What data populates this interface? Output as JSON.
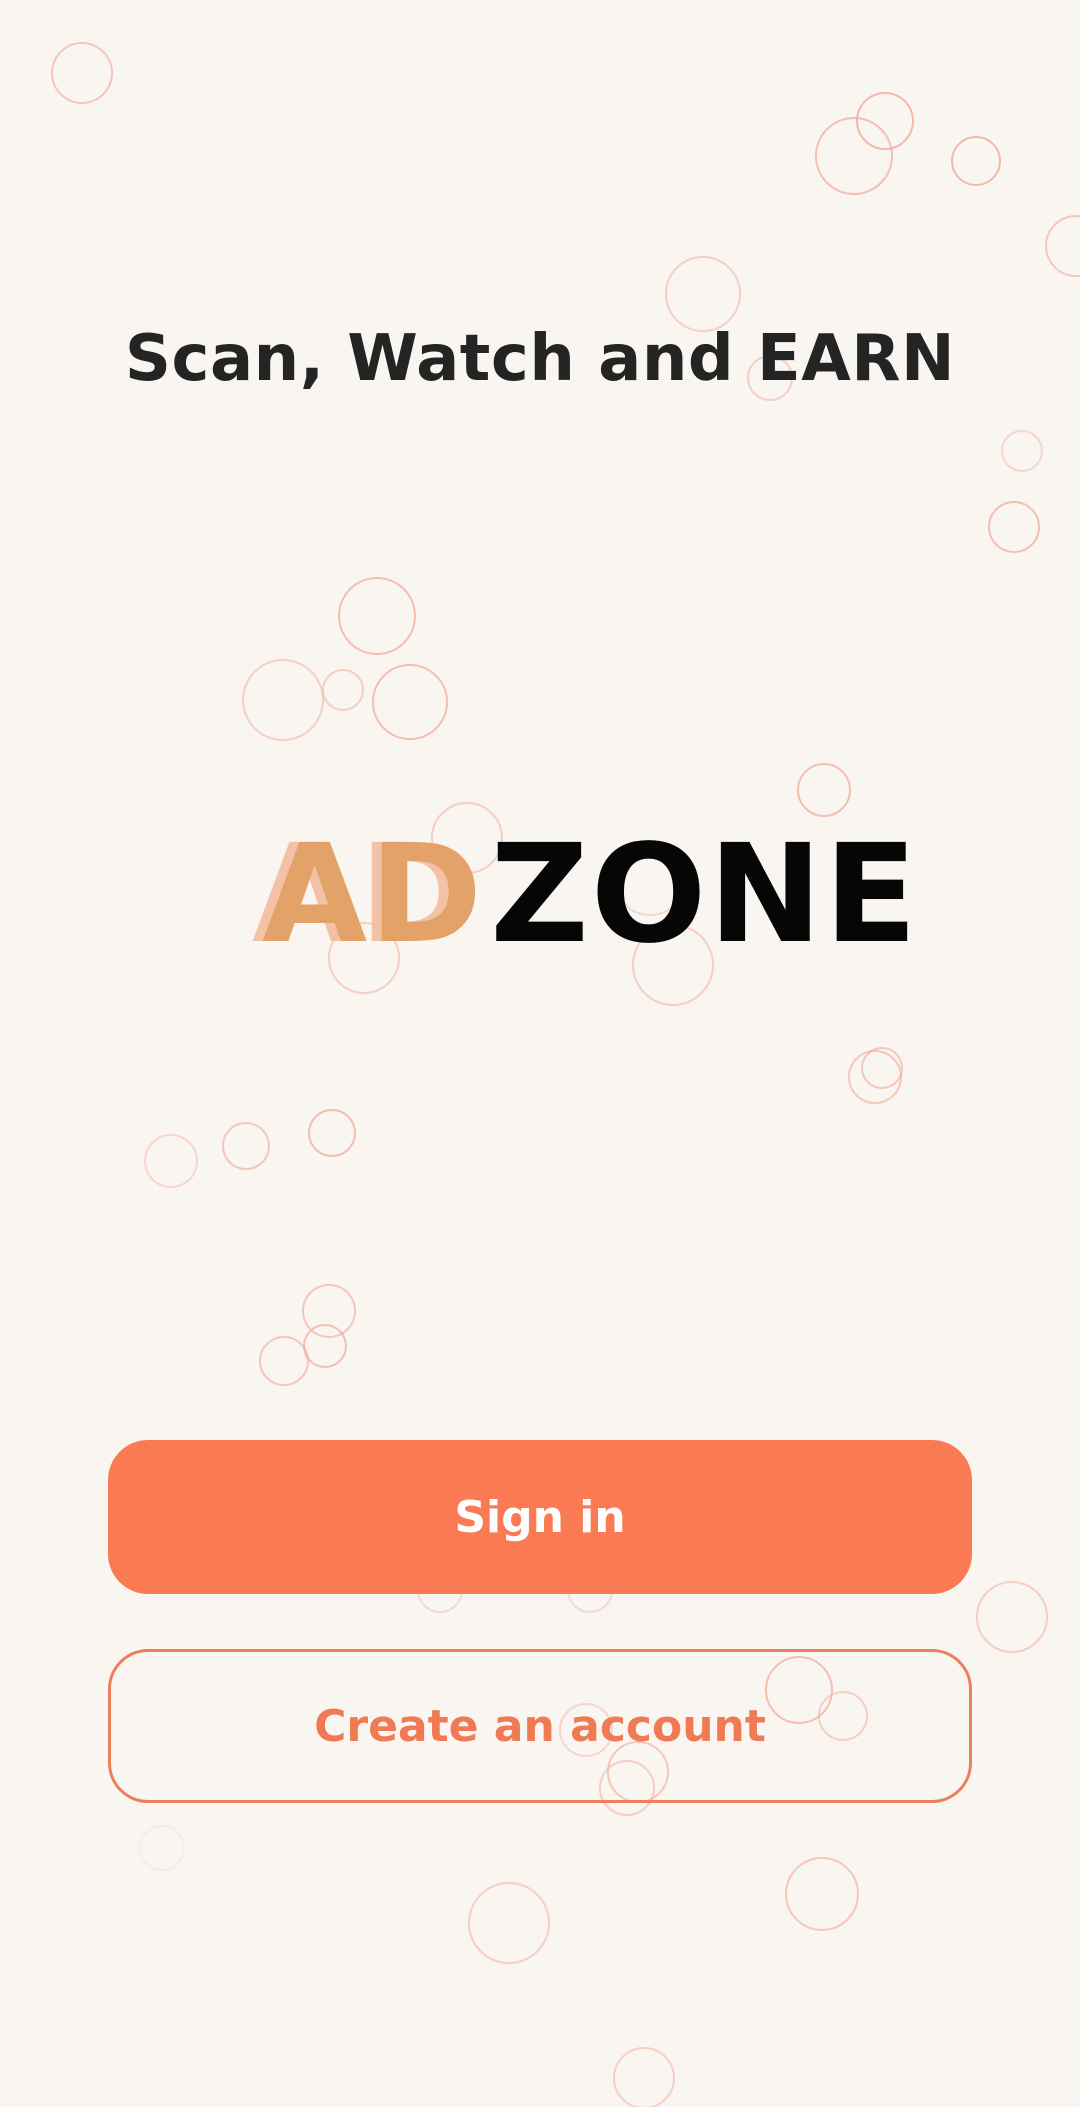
{
  "screen": {
    "tagline": "Scan, Watch and EARN"
  },
  "logo": {
    "part1": "AD",
    "part2": "ZONE"
  },
  "actions": {
    "sign_in_label": "Sign in",
    "create_account_label": "Create an account"
  },
  "colors": {
    "background": "#f9f5f1",
    "accent": "#fa7a53",
    "logo_accent": "#e3a267",
    "bubble_stroke": "#f2a797"
  }
}
